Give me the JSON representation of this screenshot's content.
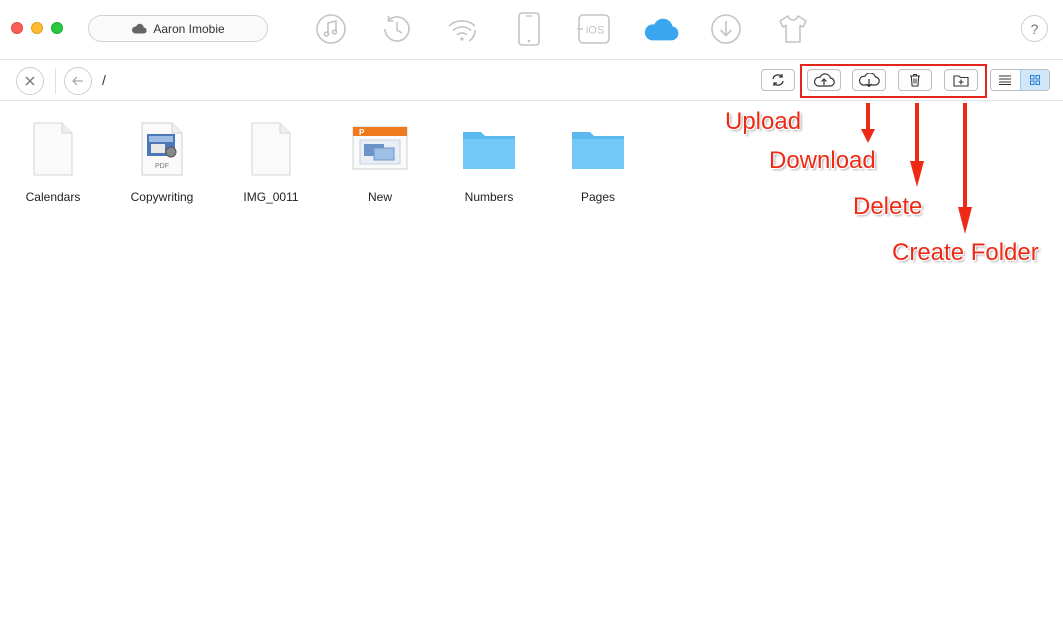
{
  "window": {
    "device_name": "Aaron  Imobie",
    "help_label": "?"
  },
  "top_nav": [
    {
      "icon": "music-icon"
    },
    {
      "icon": "history-icon"
    },
    {
      "icon": "wifi-icon"
    },
    {
      "icon": "phone-icon"
    },
    {
      "icon": "ios-icon",
      "label": "iOS"
    },
    {
      "icon": "icloud-icon",
      "active": true
    },
    {
      "icon": "download-circle-icon"
    },
    {
      "icon": "shirt-icon"
    }
  ],
  "toolbar": {
    "path": "/",
    "buttons": [
      "refresh-icon",
      "cloud-upload-icon",
      "cloud-download-icon",
      "trash-icon",
      "new-folder-icon"
    ],
    "view_modes": [
      "list-view-icon",
      "grid-view-icon"
    ],
    "active_view": "grid"
  },
  "files": [
    {
      "name": "Calendars",
      "type": "document"
    },
    {
      "name": "Copywriting",
      "type": "pdf",
      "badge": "PDF"
    },
    {
      "name": "IMG_0011",
      "type": "document"
    },
    {
      "name": "New",
      "type": "keynote",
      "badge": "P"
    },
    {
      "name": "Numbers",
      "type": "folder"
    },
    {
      "name": "Pages",
      "type": "folder"
    }
  ],
  "annotations": {
    "upload": "Upload",
    "download": "Download",
    "delete": "Delete",
    "create_folder": "Create Folder"
  },
  "colors": {
    "accent": "#3aa6f0",
    "annotation": "#ee2a17",
    "folder": "#6cc4f5",
    "icon_gray": "#c4c4c4"
  }
}
